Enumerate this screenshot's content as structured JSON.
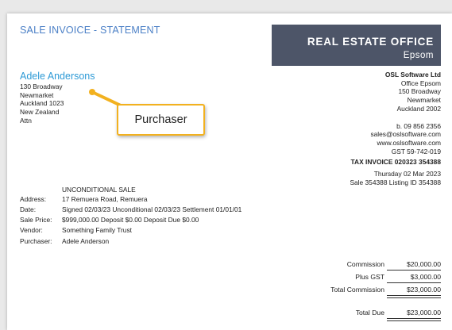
{
  "header": {
    "doc_title": "SALE INVOICE - STATEMENT",
    "banner_line1": "REAL ESTATE OFFICE",
    "banner_line2": "Epsom"
  },
  "customer": {
    "name": "Adele Andersons",
    "address_lines": [
      "130 Broadway",
      "Newmarket",
      "Auckland 1023",
      "New Zealand",
      "Attn"
    ]
  },
  "agency": {
    "company": "OSL Software Ltd",
    "lines": [
      "Office Epsom",
      "150 Broadway",
      "Newmarket",
      "Auckland 2002"
    ],
    "contact_lines": [
      "b. 09 856 2356",
      "sales@oslsoftware.com",
      "www.oslsoftware.com",
      "GST 59-742-019"
    ],
    "tax_invoice": "TAX INVOICE 020323 354388",
    "date": "Thursday 02 Mar 2023",
    "sale_ref": "Sale 354388  Listing ID 354388"
  },
  "sale": {
    "heading": "UNCONDITIONAL SALE",
    "rows": [
      {
        "label": "Address:",
        "value": "17 Remuera Road, Remuera"
      },
      {
        "label": "Date:",
        "value": "Signed 02/03/23  Unconditional 02/03/23  Settlement 01/01/01"
      },
      {
        "label": "Sale Price:",
        "value": "$999,000.00  Deposit $0.00  Deposit Due $0.00"
      },
      {
        "label": "Vendor:",
        "value": "Something Family Trust"
      },
      {
        "label": "Purchaser:",
        "value": "Adele Anderson"
      }
    ]
  },
  "totals": {
    "commission_label": "Commission",
    "commission_value": "$20,000.00",
    "gst_label": "Plus GST",
    "gst_value": "$3,000.00",
    "total_commission_label": "Total Commission",
    "total_commission_value": "$23,000.00",
    "total_due_label": "Total Due",
    "total_due_value": "$23,000.00"
  },
  "annotation": {
    "callout_text": "Purchaser",
    "accent_color": "#f2b11f"
  }
}
